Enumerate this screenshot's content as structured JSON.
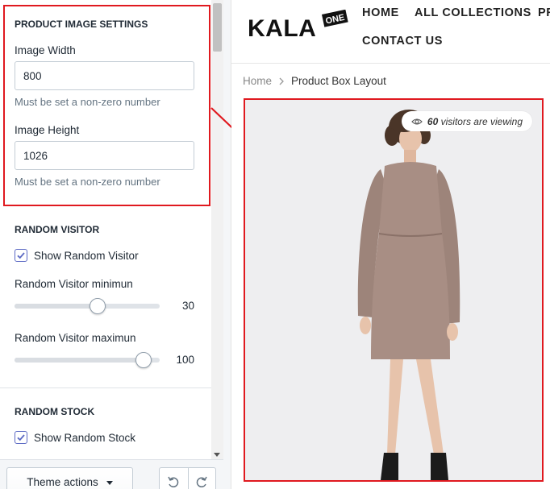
{
  "settings": {
    "image_section": {
      "title": "PRODUCT IMAGE SETTINGS",
      "width_label": "Image Width",
      "width_value": "800",
      "width_help": "Must be set a non-zero number",
      "height_label": "Image Height",
      "height_value": "1026",
      "height_help": "Must be set a non-zero number"
    },
    "random_visitor": {
      "title": "RANDOM VISITOR",
      "checkbox_label": "Show Random Visitor",
      "checked": true,
      "min_label": "Random Visitor minimun",
      "min_value": "30",
      "min_fraction": 0.58,
      "max_label": "Random Visitor maximun",
      "max_value": "100",
      "max_fraction": 0.94
    },
    "random_stock": {
      "title": "RANDOM STOCK",
      "checkbox_label": "Show Random Stock",
      "checked": true
    }
  },
  "bottom_bar": {
    "theme_actions_label": "Theme actions",
    "undo_icon": "undo-icon",
    "redo_icon": "redo-icon"
  },
  "store": {
    "logo_text": "KALA",
    "logo_badge": "ONE",
    "nav": [
      "HOME",
      "ALL COLLECTIONS",
      "PR",
      "CONTACT US"
    ],
    "breadcrumb": {
      "home": "Home",
      "current": "Product Box Layout"
    },
    "visitors": {
      "count": "60",
      "text": "visitors are viewing"
    }
  },
  "colors": {
    "highlight": "#e0191f",
    "checkbox": "#5c6ac4",
    "dress": "#a88e84",
    "photo_background": "#eeeef0"
  }
}
